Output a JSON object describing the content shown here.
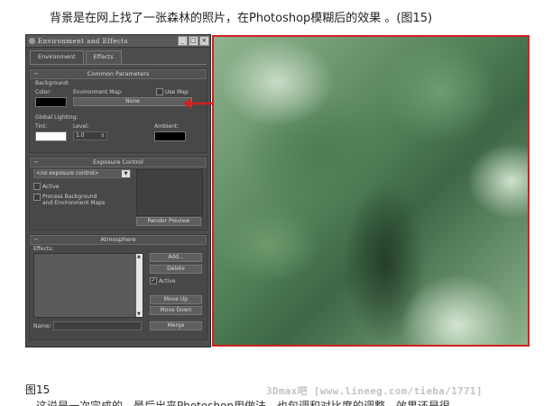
{
  "article": {
    "caption_top": "背景是在网上找了一张森林的照片，在Photoshop模糊后的效果 。(图15)",
    "caption_bottom": "图15",
    "watermark": "3Dmax吧 [www.lineeg.com/tieba/1771]",
    "cut_text": "这说是一次完成的，最后出来Photoshop用做法，也包调和对比度的调整，效果还是很"
  },
  "dialog": {
    "title": "Environment and Effects",
    "window_buttons": [
      "_",
      "□",
      "×"
    ],
    "tabs": [
      "Environment",
      "Effects"
    ],
    "common": {
      "header": "Common Parameters",
      "background_label": "Background:",
      "color_label": "Color:",
      "env_map_label": "Environment Map:",
      "use_map_label": "Use Map",
      "env_map_value": "None",
      "global_lighting_label": "Global Lighting:",
      "tint_label": "Tint:",
      "level_label": "Level:",
      "level_value": "1.0",
      "ambient_label": "Ambient:",
      "background_color": "#000000",
      "tint_color": "#ffffff",
      "ambient_color": "#000000"
    },
    "exposure": {
      "header": "Exposure Control",
      "dropdown_value": "<no exposure control>",
      "active_label": "Active",
      "process_bg_label": "Process Background\nand Environment Maps",
      "render_preview": "Render Preview"
    },
    "atmosphere": {
      "header": "Atmosphere",
      "effects_label": "Effects:",
      "add": "Add...",
      "delete": "Delete",
      "active_label": "Active",
      "move_up": "Move Up",
      "move_down": "Move Down",
      "name_label": "Name:",
      "merge": "Merge"
    }
  },
  "colors": {
    "highlight_border": "#d22020",
    "arrow": "#d22020"
  }
}
